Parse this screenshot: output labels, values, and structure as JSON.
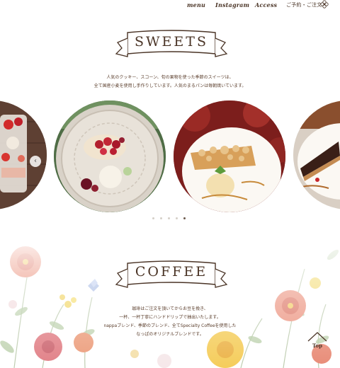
{
  "nav": {
    "menu": "menu",
    "instagram": "Instagram",
    "access": "Access",
    "reserve": "ご予約・ご注文"
  },
  "sweets": {
    "title": "SWEETS",
    "desc_line1": "人気のクッキー、スコーン、旬の果物を使った季節のスイーツは、",
    "desc_line2": "全て国産小麦を使用し手作りしています。人気のまるパンは毎朝焼いています。"
  },
  "carousel": {
    "prev_symbol": "‹",
    "dot_count": 5,
    "active_dot": 4
  },
  "coffee": {
    "title": "COFFEE",
    "desc_line1": "珈琲はご注文を頂いてからお豆を挽き、",
    "desc_line2": "一杯、一杯丁寧にハンドドリップで抽出いたします。",
    "desc_line3": "nappaブレンド、季節のブレンド、全てSpecialty Coffeeを使用した",
    "desc_line4": "なっぱのオリジナルブレンドです。"
  },
  "top_button": {
    "label": "Top"
  },
  "colors": {
    "text_brown": "#4a3426",
    "accent_brown": "#5a3d2b",
    "dot_inactive": "#d5cfc8",
    "dot_active": "#6b5a4c"
  }
}
